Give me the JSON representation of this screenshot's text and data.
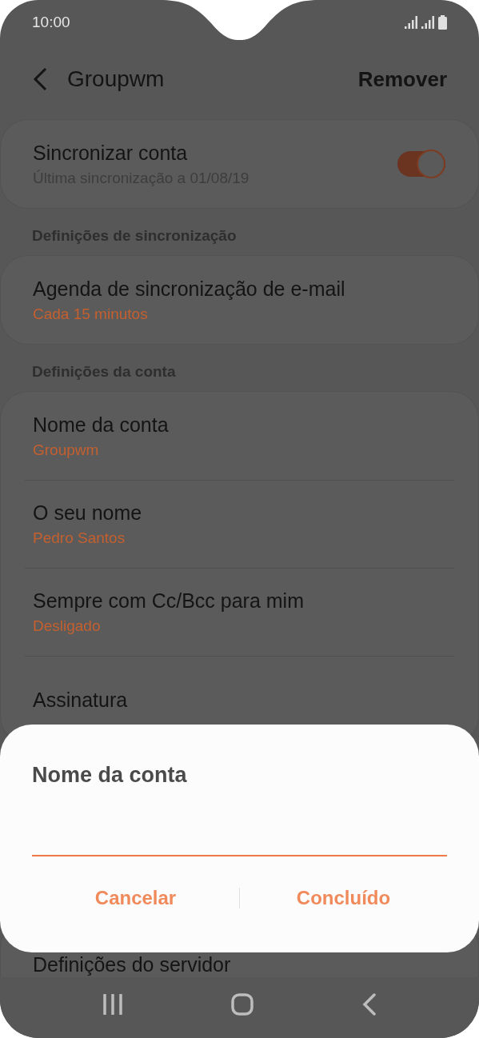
{
  "status_bar": {
    "time": "10:00"
  },
  "header": {
    "title": "Groupwm",
    "action": "Remover"
  },
  "sections": [
    {
      "items": [
        {
          "kind": "toggle",
          "title": "Sincronizar conta",
          "subtitle": "Última sincronização a 01/08/19",
          "on": true
        }
      ]
    },
    {
      "heading": "Definições de sincronização",
      "items": [
        {
          "kind": "value",
          "title": "Agenda de sincronização de e-mail",
          "value": "Cada 15 minutos"
        }
      ]
    },
    {
      "heading": "Definições da conta",
      "items": [
        {
          "kind": "value",
          "title": "Nome da conta",
          "value": "Groupwm"
        },
        {
          "kind": "value",
          "title": "O seu nome",
          "value": "Pedro Santos"
        },
        {
          "kind": "value",
          "title": "Sempre com Cc/Bcc para mim",
          "value": "Desligado"
        },
        {
          "kind": "plain",
          "title": "Assinatura"
        }
      ]
    },
    {
      "items": [
        {
          "kind": "plain",
          "title": "Definições do servidor"
        }
      ]
    }
  ],
  "dialog": {
    "title": "Nome da conta",
    "buttons": [
      "Cancelar",
      "Concluído"
    ]
  }
}
